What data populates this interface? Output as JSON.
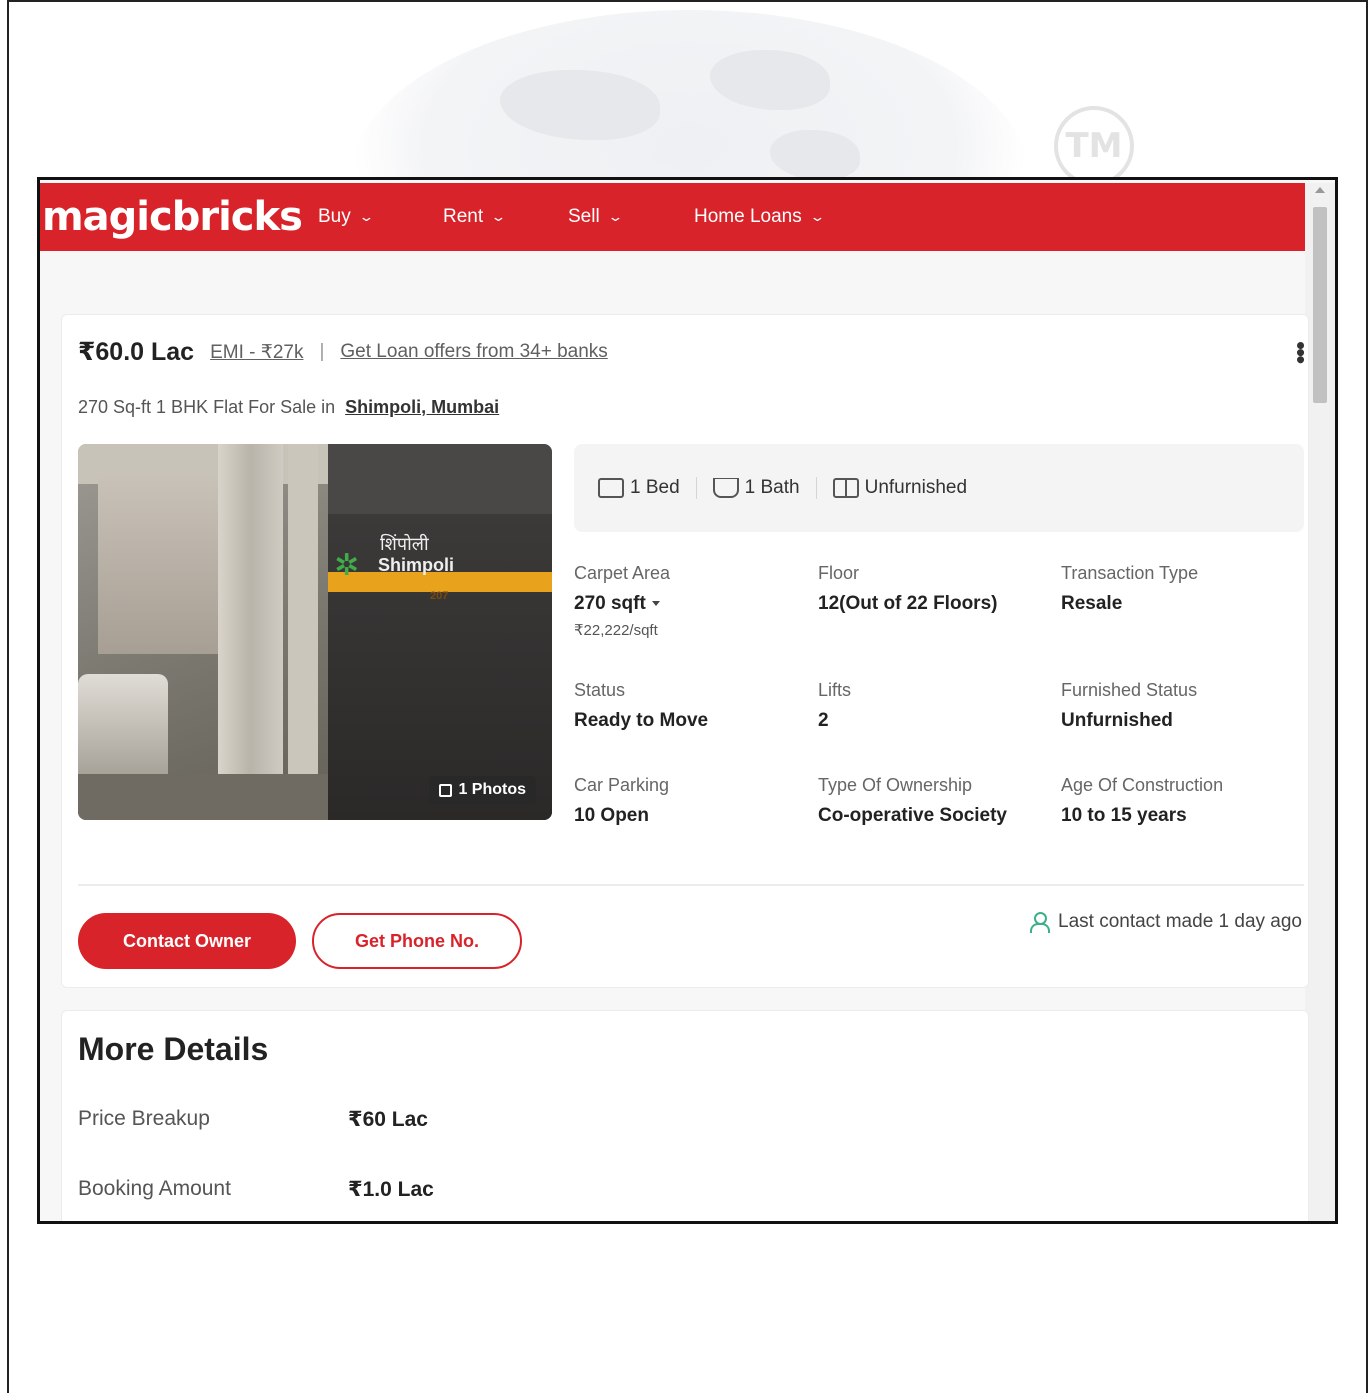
{
  "watermark": {
    "tm": "TM"
  },
  "navbar": {
    "logo": "magicbricks",
    "items": [
      {
        "label": "Buy"
      },
      {
        "label": "Rent"
      },
      {
        "label": "Sell"
      },
      {
        "label": "Home Loans"
      }
    ]
  },
  "listing": {
    "price": "₹60.0 Lac",
    "emi": "EMI - ₹27k",
    "separator": "|",
    "loan_offer": "Get Loan offers from 34+ banks",
    "subtitle": "270 Sq-ft 1 BHK Flat For Sale in",
    "locality": "Shimpoli, Mumbai",
    "photo": {
      "badge": "1 Photos",
      "sign_hindi": "शिंपोली",
      "sign_english": "Shimpoli",
      "sign_number": "207"
    },
    "summary": [
      {
        "label": "1 Bed",
        "icon": "bed-icon"
      },
      {
        "label": "1 Bath",
        "icon": "bath-icon"
      },
      {
        "label": "Unfurnished",
        "icon": "furnishing-icon"
      }
    ],
    "details": {
      "carpet_area": {
        "label": "Carpet Area",
        "value": "270 sqft",
        "sub": "₹22,222/sqft"
      },
      "floor": {
        "label": "Floor",
        "value": "12(Out of 22 Floors)"
      },
      "transaction_type": {
        "label": "Transaction Type",
        "value": "Resale"
      },
      "status": {
        "label": "Status",
        "value": "Ready to Move"
      },
      "lifts": {
        "label": "Lifts",
        "value": "2"
      },
      "furnished_status": {
        "label": "Furnished Status",
        "value": "Unfurnished"
      },
      "car_parking": {
        "label": "Car Parking",
        "value": "10 Open"
      },
      "ownership": {
        "label": "Type Of Ownership",
        "value": "Co-operative Society"
      },
      "age": {
        "label": "Age Of Construction",
        "value": "10 to 15 years"
      }
    },
    "actions": {
      "contact_owner": "Contact Owner",
      "get_phone": "Get Phone No.",
      "last_contact": "Last contact made 1 day ago"
    }
  },
  "more_details": {
    "title": "More Details",
    "rows": [
      {
        "label": "Price Breakup",
        "value": "₹60 Lac"
      },
      {
        "label": "Booking Amount",
        "value": "₹1.0 Lac"
      }
    ]
  },
  "colors": {
    "brand_red": "#d8232a",
    "contact_green": "#3fae8a"
  }
}
